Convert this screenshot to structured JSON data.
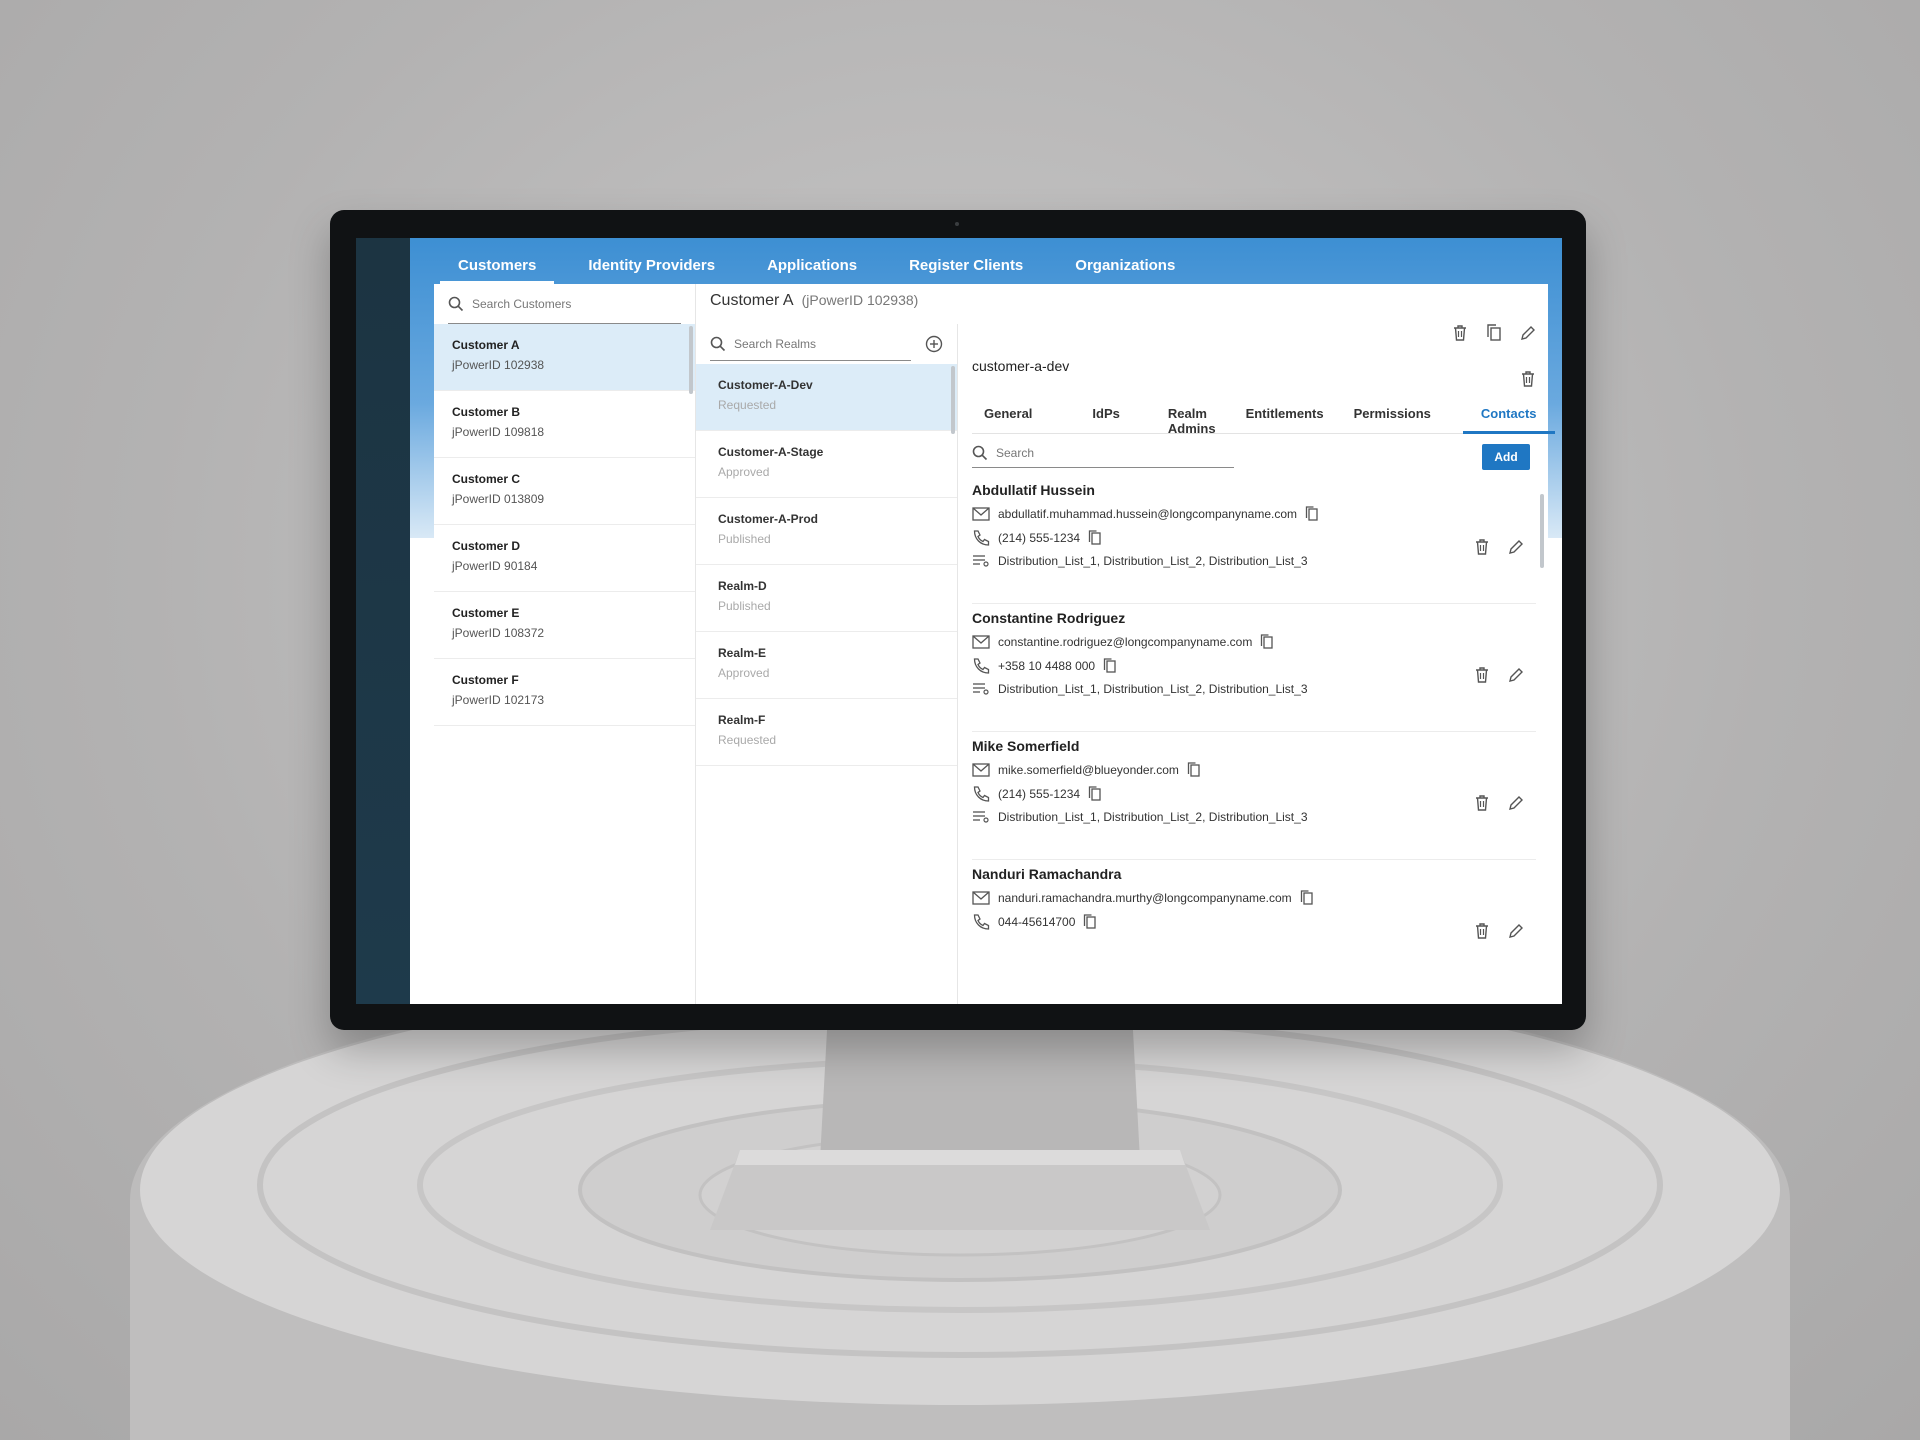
{
  "nav": {
    "tabs": [
      "Customers",
      "Identity Providers",
      "Applications",
      "Register Clients",
      "Organizations"
    ],
    "active": "Customers"
  },
  "customers": {
    "search_placeholder": "Search Customers",
    "items": [
      {
        "name": "Customer A",
        "id": "jPowerID  102938"
      },
      {
        "name": "Customer B",
        "id": "jPowerID  109818"
      },
      {
        "name": "Customer C",
        "id": "jPowerID  013809"
      },
      {
        "name": "Customer D",
        "id": "jPowerID  90184"
      },
      {
        "name": "Customer E",
        "id": "jPowerID  108372"
      },
      {
        "name": "Customer F",
        "id": "jPowerID  102173"
      }
    ]
  },
  "selected_customer": {
    "title": "Customer A",
    "subtitle": "(jPowerID 102938)"
  },
  "realms": {
    "search_placeholder": "Search Realms",
    "items": [
      {
        "name": "Customer-A-Dev",
        "status": "Requested"
      },
      {
        "name": "Customer-A-Stage",
        "status": "Approved"
      },
      {
        "name": "Customer-A-Prod",
        "status": "Published"
      },
      {
        "name": "Realm-D",
        "status": "Published"
      },
      {
        "name": "Realm-E",
        "status": "Approved"
      },
      {
        "name": "Realm-F",
        "status": "Requested"
      }
    ]
  },
  "realm_detail": {
    "title": "customer-a-dev",
    "tabs": [
      "General",
      "IdPs",
      "Realm Admins",
      "Entitlements",
      "Permissions",
      "Contacts"
    ],
    "active_tab": "Contacts",
    "search_placeholder": "Search",
    "add_label": "Add"
  },
  "contacts": [
    {
      "name": "Abdullatif Hussein",
      "email": "abdullatif.muhammad.hussein@longcompanyname.com",
      "phone": "(214) 555-1234",
      "lists": "Distribution_List_1, Distribution_List_2, Distribution_List_3"
    },
    {
      "name": "Constantine Rodriguez",
      "email": "constantine.rodriguez@longcompanyname.com",
      "phone": "+358 10 4488 000",
      "lists": "Distribution_List_1, Distribution_List_2, Distribution_List_3"
    },
    {
      "name": "Mike Somerfield",
      "email": "mike.somerfield@blueyonder.com",
      "phone": "(214) 555-1234",
      "lists": "Distribution_List_1, Distribution_List_2, Distribution_List_3"
    },
    {
      "name": "Nanduri Ramachandra",
      "email": "nanduri.ramachandra.murthy@longcompanyname.com",
      "phone": "044-45614700",
      "lists": ""
    }
  ],
  "colors": {
    "accent": "#1f77c3",
    "nav_band": "#3d8fd3",
    "selected_row": "#dcecf8",
    "rail": "#1c3442"
  },
  "icons": [
    "search-icon",
    "add-circle-icon",
    "trash-icon",
    "copy-icon",
    "edit-icon",
    "mail-icon",
    "phone-icon",
    "list-icon"
  ]
}
